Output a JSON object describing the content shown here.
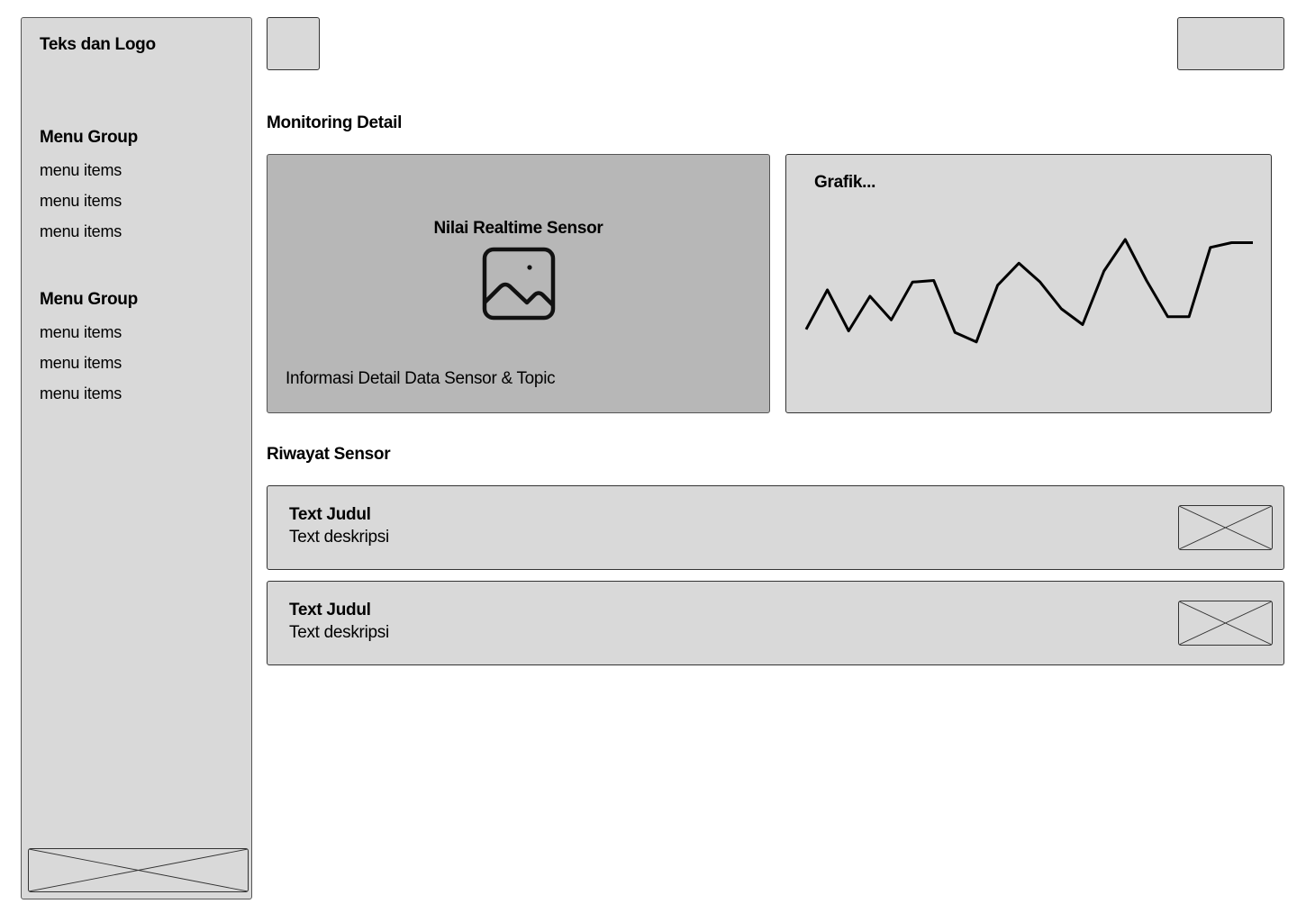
{
  "sidebar": {
    "brand": "Teks dan Logo",
    "groups": [
      {
        "title": "Menu Group",
        "items": [
          "menu items",
          "menu items",
          "menu items"
        ]
      },
      {
        "title": "Menu Group",
        "items": [
          "menu items",
          "menu items",
          "menu items"
        ]
      }
    ],
    "footer_image": "image-placeholder-icon"
  },
  "header": {
    "left_button_icon": "placeholder",
    "right_button_icon": "placeholder"
  },
  "monitoring": {
    "section_title": "Monitoring Detail",
    "sensor_card": {
      "title": "Nilai Realtime Sensor",
      "icon": "image-icon",
      "info": "Informasi Detail Data Sensor & Topic"
    },
    "chart_card": {
      "title": "Grafik..."
    }
  },
  "chart_data": {
    "type": "line",
    "title": "Grafik...",
    "xlabel": "",
    "ylabel": "",
    "grid": false,
    "series": [
      {
        "values": [
          0.35,
          0.6,
          0.34,
          0.56,
          0.41,
          0.65,
          0.66,
          0.33,
          0.27,
          0.63,
          0.77,
          0.65,
          0.48,
          0.38,
          0.72,
          0.92,
          0.66,
          0.43,
          0.43,
          0.87,
          0.9,
          0.9
        ]
      }
    ]
  },
  "history": {
    "section_title": "Riwayat Sensor",
    "rows": [
      {
        "title": "Text Judul",
        "description": "Text deskripsi"
      },
      {
        "title": "Text Judul",
        "description": "Text deskripsi"
      }
    ]
  }
}
